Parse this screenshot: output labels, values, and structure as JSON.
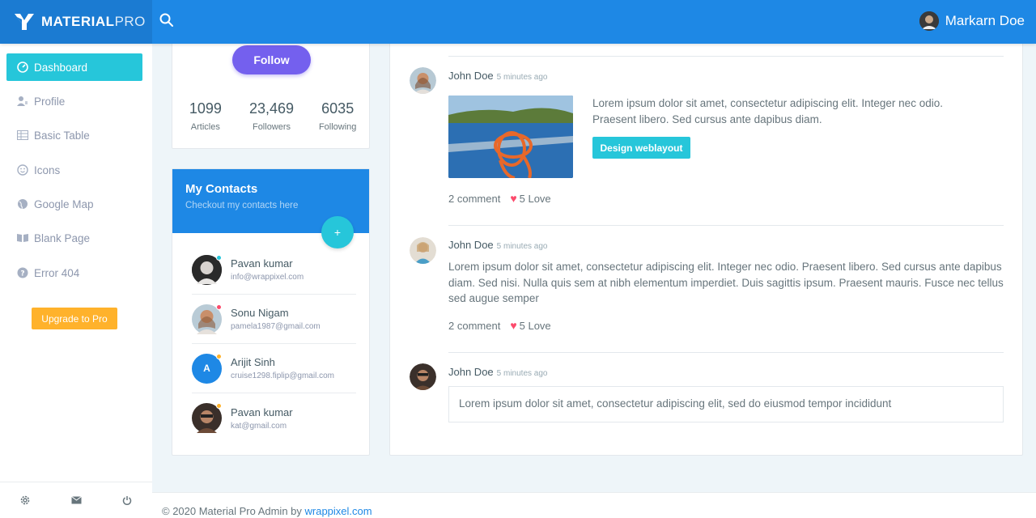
{
  "brand": {
    "name_bold": "MATERIAL",
    "name_light": "PRO",
    "accent": "#1e88e5"
  },
  "topbar": {
    "search_icon": "search-icon",
    "user_name": "Markarn Doe"
  },
  "sidebar": {
    "items": [
      {
        "label": "Dashboard",
        "icon": "dashboard-icon",
        "active": true
      },
      {
        "label": "Profile",
        "icon": "user-icon"
      },
      {
        "label": "Basic Table",
        "icon": "table-icon"
      },
      {
        "label": "Icons",
        "icon": "smiley-icon"
      },
      {
        "label": "Google Map",
        "icon": "globe-icon"
      },
      {
        "label": "Blank Page",
        "icon": "book-icon"
      },
      {
        "label": "Error 404",
        "icon": "help-icon"
      }
    ],
    "upgrade_label": "Upgrade to Pro",
    "footer_icons": [
      "settings-icon",
      "mail-icon",
      "power-icon"
    ]
  },
  "profile": {
    "follow_label": "Follow",
    "stats": [
      {
        "value": "1099",
        "label": "Articles"
      },
      {
        "value": "23,469",
        "label": "Followers"
      },
      {
        "value": "6035",
        "label": "Following"
      }
    ]
  },
  "contacts": {
    "title": "My Contacts",
    "subtitle": "Checkout my contacts here",
    "add_label": "+",
    "list": [
      {
        "name": "Pavan kumar",
        "email": "info@wrappixel.com",
        "status_color": "#26c6da"
      },
      {
        "name": "Sonu Nigam",
        "email": "pamela1987@gmail.com",
        "status_color": "#fc4b6c"
      },
      {
        "name": "Arijit Sinh",
        "email": "cruise1298.fiplip@gmail.com",
        "status_color": "#ffb22b",
        "initial": "A"
      },
      {
        "name": "Pavan kumar",
        "email": "kat@gmail.com",
        "status_color": "#ffb22b"
      }
    ]
  },
  "feed": {
    "posts": [
      {
        "author": "John Doe",
        "time": "5 minutes ago",
        "text": "Lorem ipsum dolor sit amet, consectetur adipiscing elit. Integer nec odio. Praesent libero. Sed cursus ante dapibus diam.",
        "button": "Design weblayout",
        "comments": "2 comment",
        "love": "5 Love"
      },
      {
        "author": "John Doe",
        "time": "5 minutes ago",
        "text": "Lorem ipsum dolor sit amet, consectetur adipiscing elit. Integer nec odio. Praesent libero. Sed cursus ante dapibus diam. Sed nisi. Nulla quis sem at nibh elementum imperdiet. Duis sagittis ipsum. Praesent mauris. Fusce nec tellus sed augue semper",
        "comments": "2 comment",
        "love": "5 Love"
      },
      {
        "author": "John Doe",
        "time": "5 minutes ago",
        "quote": "Lorem ipsum dolor sit amet, consectetur adipiscing elit, sed do eiusmod tempor incididunt"
      }
    ]
  },
  "footer": {
    "text": "© 2020 Material Pro Admin by ",
    "link": "wrappixel.com"
  }
}
